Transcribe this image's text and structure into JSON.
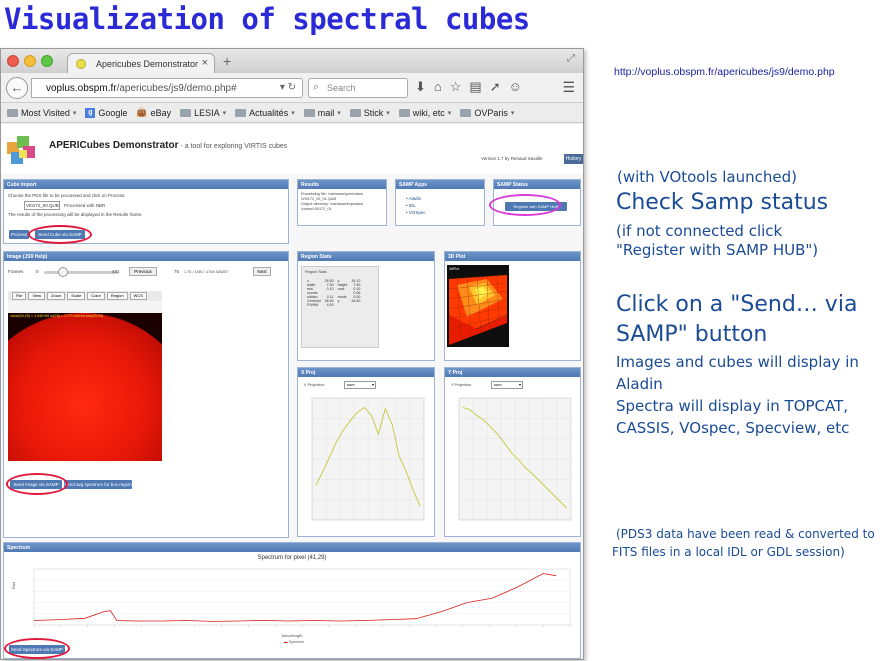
{
  "slide": {
    "title": "Visualization of spectral cubes",
    "demo_url": "http://voplus.obspm.fr/apericubes/js9/demo.php",
    "note_launch": "(with VOtools launched)",
    "heading_samp": "Check Samp status",
    "note_connect_1": "(if not connected click",
    "note_connect_2": "\"Register with SAMP HUB\")",
    "heading_send_1": "Click on a \"Send… via",
    "heading_send_2": "SAMP\" button",
    "display_1": "Images and cubes will display in",
    "display_2": "Aladin",
    "display_3": "Spectra will display in TOPCAT,",
    "display_4": "CASSIS, VOspec, Specview, etc",
    "pds_1": "(PDS3 data have been read & converted to",
    "pds_2": "FITS files in a local IDL or GDL session)"
  },
  "browser": {
    "tab_title": "Apericubes Demonstrator",
    "url_domain": "voplus.obspm.fr",
    "url_path": "/apericubes/js9/demo.php#",
    "search_placeholder": "Search",
    "bookmarks": [
      "Most Visited",
      "Google",
      "eBay",
      "LESIA",
      "Actualités",
      "mail",
      "Stick",
      "wiki, etc",
      "OVParis"
    ]
  },
  "app": {
    "title": "APERICubes Demonstrator",
    "subtitle": " - a tool for exploring VIRTIS cubes",
    "version": "Version 1.7 by Renaud Savalle",
    "history": "History"
  },
  "cube_import": {
    "header": "Cube import",
    "instructions": "Choose the PDS file to be processed and click on Process.",
    "file_value": "VI0172_00.QUB",
    "detected": "Processed with NBR",
    "results_note": "The results of the processing will be displayed in the Results frame.",
    "process_button": "Process",
    "send_cube_button": "Send Cube via SAMP"
  },
  "results": {
    "header": "Results",
    "lines": [
      "Processing file: /var/www/apericubes",
      "/VI0172_00_01.QUB",
      "Output directory: /var/www/expcubes",
      "/cubes/VI0172_01"
    ]
  },
  "samp_apps": {
    "header": "SAMP Apps",
    "apps": [
      "Aladin",
      "IDL",
      "VOSpec"
    ]
  },
  "samp_status": {
    "header": "SAMP Status",
    "register_button": "Register with SAMP HUB"
  },
  "image_panel": {
    "header": "Image (JS9 Help)",
    "frames_label": "Frames",
    "frame_min": "0",
    "frame_max": "431",
    "previous_button": "Previous",
    "frame_num": "75",
    "frame_info": "1.75 / 1451 / 1704 428257",
    "next_button": "Next",
    "toolbar": [
      "File",
      "View",
      "Zoom",
      "Scale",
      "Color",
      "Region",
      "WCS"
    ],
    "overlay_text": "value(43,29) = 1.040+00  wl(75) = 1.771 micron  pos(43,29)",
    "send_image_button": "Send Image via SAMP",
    "send_avg_button": "Send avg spectrum for box region"
  },
  "region_stats": {
    "header": "Region Stats",
    "label": "Region Stats",
    "rows": [
      [
        "x",
        "26.50",
        "y",
        "35.10"
      ],
      [
        "width",
        "7.50",
        "height",
        "7.50"
      ],
      [
        "min",
        "0.10",
        "max",
        "0.10"
      ],
      [
        "counts",
        "",
        "",
        "0.06"
      ],
      [
        "stddev",
        "0.11",
        "mode",
        "0.00"
      ],
      [
        "Centroid",
        "26.50",
        "y",
        "34.80"
      ],
      [
        "FWHM",
        "4.00",
        "",
        ""
      ]
    ]
  },
  "plot3d": {
    "header": "3D Plot",
    "label": "3dPlot"
  },
  "xproj": {
    "header": "X Proj",
    "label": "X Projection",
    "select": "sum",
    "chart_data": {
      "type": "line",
      "x": [
        0,
        1,
        2,
        3,
        4,
        5,
        6,
        7,
        8,
        9,
        10,
        11,
        12,
        13,
        14,
        15
      ],
      "values": [
        0.3,
        0.42,
        0.55,
        0.68,
        0.78,
        0.86,
        0.93,
        0.97,
        0.9,
        0.74,
        0.96,
        0.82,
        0.55,
        0.42,
        0.26,
        0.12
      ],
      "ylim": [
        0,
        1
      ]
    }
  },
  "yproj": {
    "header": "Y Proj",
    "label": "Y Projection",
    "select": "sum",
    "chart_data": {
      "type": "line",
      "x": [
        0,
        1,
        2,
        3,
        4,
        5,
        6,
        7,
        8,
        9,
        10,
        11,
        12,
        13,
        14,
        15
      ],
      "values": [
        0.97,
        0.95,
        0.9,
        0.86,
        0.8,
        0.74,
        0.66,
        0.58,
        0.52,
        0.45,
        0.4,
        0.34,
        0.28,
        0.22,
        0.16,
        0.1
      ],
      "ylim": [
        0,
        1
      ]
    }
  },
  "spectrum": {
    "header": "Spectrum",
    "title": "Spectrum for pixel (41,29)",
    "ylabel": "Rad",
    "xlabel": "Wavelength",
    "legend": "Spectrum",
    "send_button": "Send Spectrum via SAMP",
    "chart_data": {
      "type": "line",
      "x": [
        1.0,
        1.2,
        1.4,
        1.55,
        1.6,
        1.65,
        1.8,
        2.0,
        2.2,
        2.4,
        2.6,
        2.8,
        3.0,
        3.2,
        3.4,
        3.6,
        3.8,
        4.0,
        4.2,
        4.4,
        4.6,
        4.8,
        5.0,
        5.1
      ],
      "values": [
        0.01,
        0.012,
        0.015,
        0.03,
        0.032,
        0.01,
        0.009,
        0.009,
        0.01,
        0.008,
        0.009,
        0.01,
        0.009,
        0.01,
        0.009,
        0.01,
        0.012,
        0.014,
        0.03,
        0.05,
        0.06,
        0.085,
        0.115,
        0.11
      ],
      "ylim": [
        0,
        0.125
      ]
    }
  }
}
